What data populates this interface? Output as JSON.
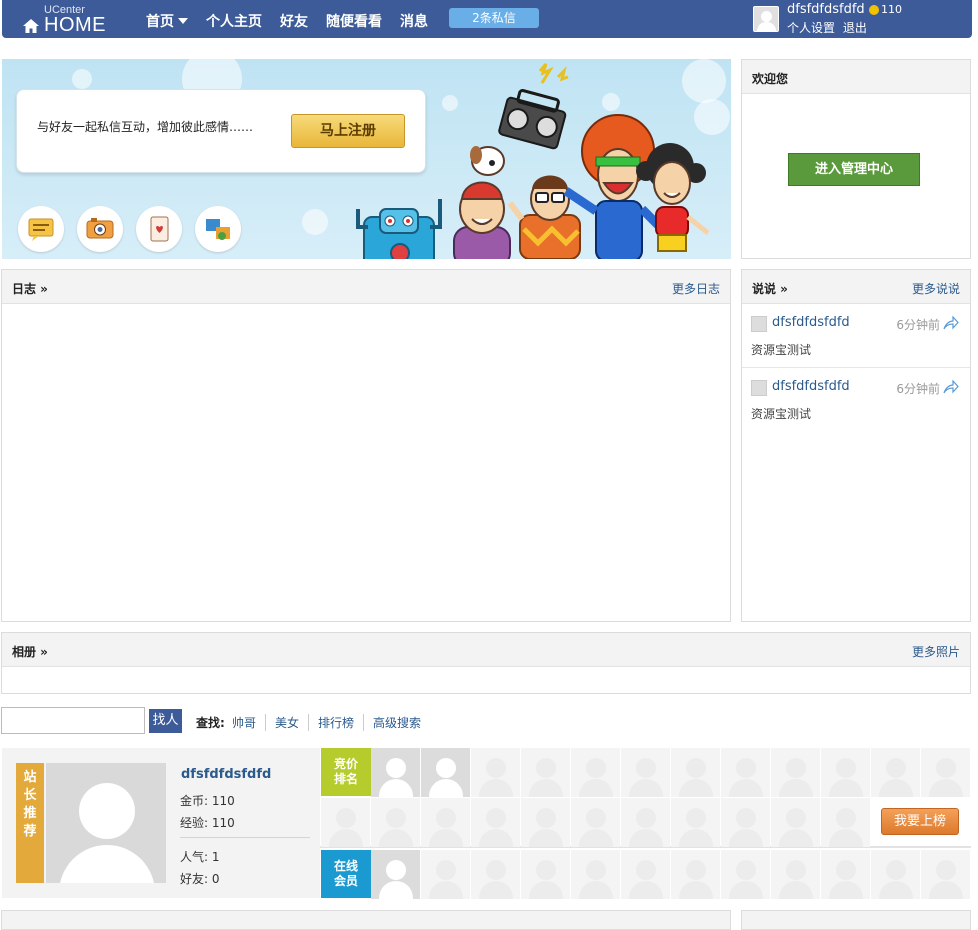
{
  "header": {
    "logo_top": "UCenter",
    "logo_main": "HOME",
    "nav": [
      "首页",
      "个人主页",
      "好友",
      "随便看看",
      "消息"
    ],
    "pm_badge": "2条私信",
    "user_name": "dfsfdfdsfdfd",
    "coins": "110",
    "settings_link": "个人设置",
    "logout_link": "退出"
  },
  "banner": {
    "text": "与好友一起私信互动，增加彼此感情……",
    "register_button": "马上注册",
    "feature_icons": [
      "message-icon",
      "camera-icon",
      "card-icon",
      "people-icon"
    ]
  },
  "welcome": {
    "title": "欢迎您",
    "manage_button": "进入管理中心"
  },
  "blog": {
    "title": "日志 »",
    "more": "更多日志"
  },
  "talk": {
    "title": "说说 »",
    "more": "更多说说",
    "items": [
      {
        "name": "dfsfdfdsfdfd",
        "time": "6分钟前",
        "content": "资源宝测试"
      },
      {
        "name": "dfsfdfdsfdfd",
        "time": "6分钟前",
        "content": "资源宝测试"
      }
    ]
  },
  "album": {
    "title": "相册 »",
    "more": "更多照片"
  },
  "search": {
    "button": "找人",
    "find_label": "查找:",
    "links": [
      "帅哥",
      "美女",
      "排行榜",
      "高级搜索"
    ]
  },
  "star": {
    "ribbon": "站长推荐",
    "name": "dfsfdfdsfdfd",
    "coins": "金币: 110",
    "exp": "经验: 110",
    "popularity": "人气: 1",
    "friends": "好友: 0"
  },
  "ranking": {
    "bid_ribbon": "竞价排名",
    "online_ribbon": "在线会员",
    "rank_button": "我要上榜"
  },
  "colors": {
    "brand": "#3d5b98",
    "green": "#5a9a3c",
    "orange": "#dd7a2c",
    "star_ribbon": "#e3a93a",
    "bid_ribbon": "#b6cc2c",
    "online_ribbon": "#1a9ad0"
  }
}
